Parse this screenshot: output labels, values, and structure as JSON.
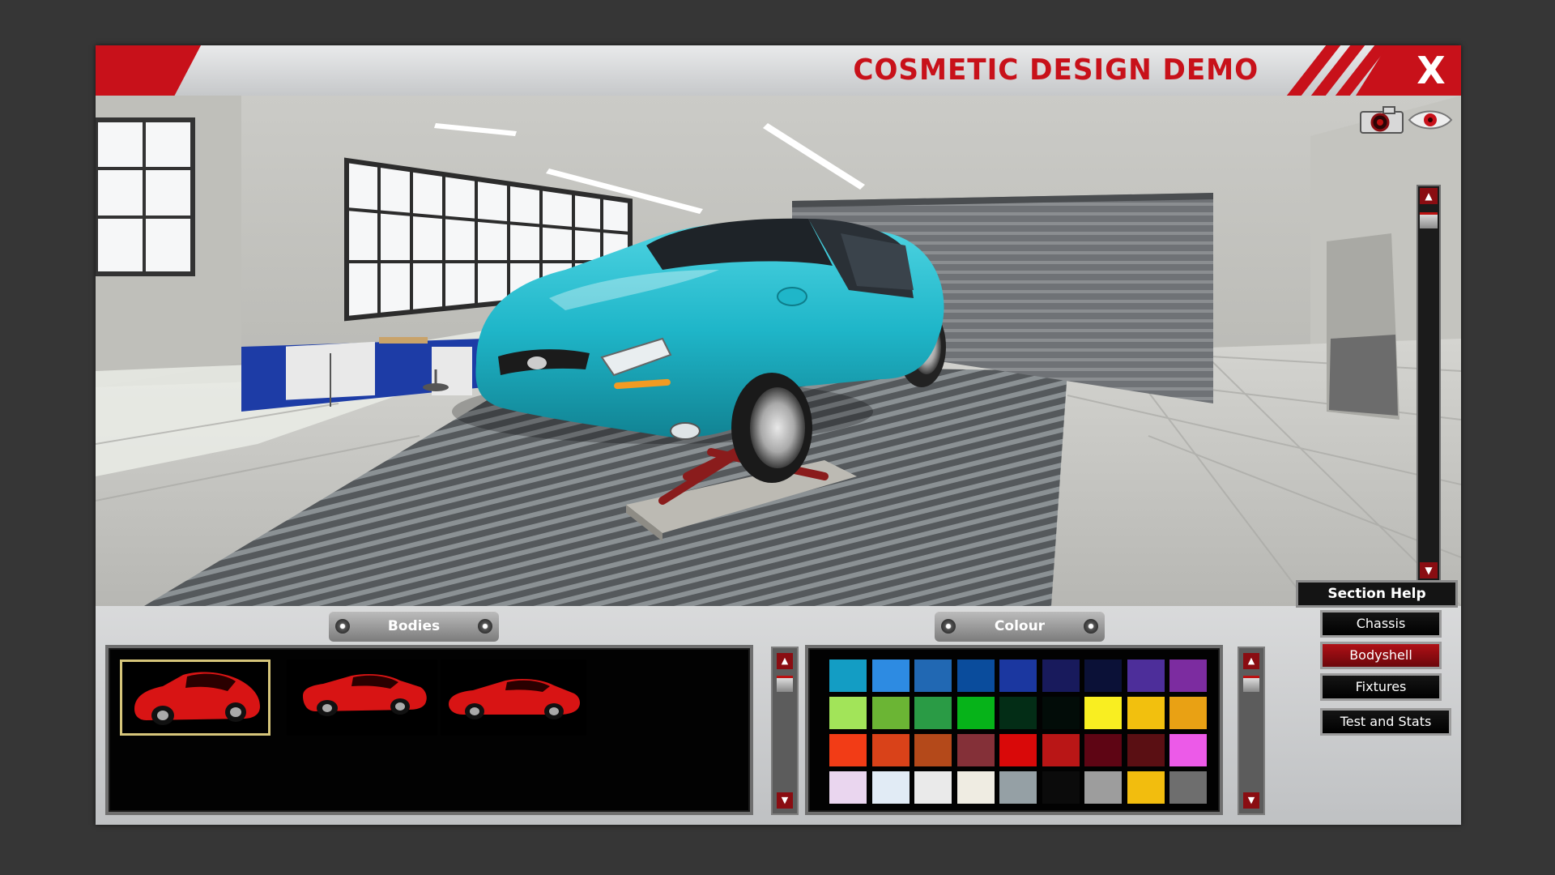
{
  "window": {
    "title": "COSMETIC DESIGN DEMO",
    "close_label": "X"
  },
  "panels": {
    "bodies_label": "Bodies",
    "colour_label": "Colour"
  },
  "section_help": {
    "title": "Section Help",
    "items": [
      {
        "label": "Chassis",
        "active": false
      },
      {
        "label": "Bodyshell",
        "active": true
      },
      {
        "label": "Fixtures",
        "active": false
      },
      {
        "label": "Test and Stats",
        "active": false
      }
    ]
  },
  "bodies": [
    {
      "name": "hatchback",
      "selected": true
    },
    {
      "name": "sedan",
      "selected": false
    },
    {
      "name": "coupe",
      "selected": false
    }
  ],
  "colour_rows": [
    [
      "#139dc4",
      "#2d8be2",
      "#2168b3",
      "#0a4c9c",
      "#1b37a0",
      "#181a5c",
      "#0b1137",
      "#4d2e9a",
      "#7c2ca0"
    ],
    [
      "#a2e459",
      "#6bb534",
      "#2a9b45",
      "#06b319",
      "#032d16",
      "#020c08",
      "#f9ee21",
      "#f2c00e",
      "#e9a114"
    ],
    [
      "#f23c16",
      "#d94219",
      "#b4491a",
      "#843038",
      "#d90909",
      "#b91616",
      "#5e0514",
      "#5a0f13",
      "#ec5ae8"
    ],
    [
      "#ead6ef",
      "#e1ebf5",
      "#eaeaea",
      "#efece2",
      "#95a0a5",
      "#0b0b0b",
      "#9d9d9d",
      "#f2bd0e",
      "#6e6e6e"
    ]
  ],
  "car_color": "#1fb6c9"
}
